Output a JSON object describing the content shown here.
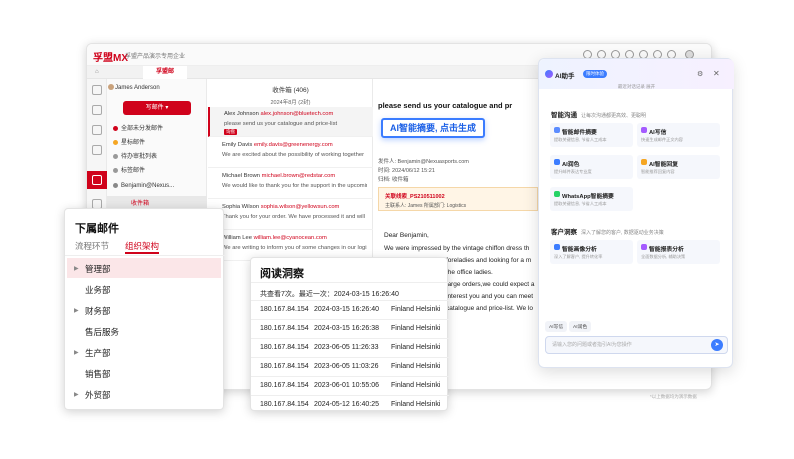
{
  "app": {
    "logo": "孚盟MX",
    "org": "孚盟产品演示专用企业",
    "tabs": {
      "home": "⌂",
      "active": "孚盟邮"
    }
  },
  "folders": {
    "user": "James Anderson",
    "compose": "写邮件 ▾",
    "items": [
      "全部未分发邮件",
      "星标邮件",
      "待办审批列表",
      "标签邮件",
      "Benjamin@Nexus...",
      "收件箱"
    ]
  },
  "list": {
    "title": "收件箱 (406)",
    "date": "2024年8月 (2封)",
    "mails": [
      {
        "name": "Alex Johnson",
        "email": "alex.johnson@bluetech.com",
        "snippet": "please send us your catalogue and price-list",
        "tag": "询盘"
      },
      {
        "name": "Emily Davis",
        "email": "emily.davis@greenenergy.com",
        "snippet": "We are excited about the possibility of working together",
        "tag": ""
      },
      {
        "name": "Michael Brown",
        "email": "michael.brown@redstar.com",
        "snippet": "We would like to thank you for the support in the upcoming",
        "tag": ""
      },
      {
        "name": "Sophia Wilson",
        "email": "sophia.wilson@yellowsun.com",
        "snippet": "Thank you for your order. We have processed it and will",
        "tag": ""
      },
      {
        "name": "William Lee",
        "email": "william.lee@cyanocean.com",
        "snippet": "We are writing to inform you of some changes in our logistics",
        "tag": ""
      }
    ]
  },
  "reader": {
    "subject": "please send us your catalogue and pr",
    "from": "发件人: Benjamin@Nexuasports.com",
    "time": "时间: 2024/06/12 15:21",
    "folder": "归档: 收件箱",
    "link_title": "关联线索_PS210511002",
    "link_detail": "主联系人: James   所属部门: Logistics",
    "greeting": "Dear Benjamin,",
    "lines": [
      "We were impressed by the vintage chiffon dress th",
      "foreladies and looking for a m",
      "the office ladies.",
      "large orders,we could expect a",
      "interest you and you can meet",
      "catalogue and price-list. We lo"
    ]
  },
  "ai_summary": "AI智能摘要, 点击生成",
  "ai": {
    "title": "AI助手",
    "badge": "限时体验",
    "sub": "最近对话记录  展开",
    "section1": {
      "title": "智能沟通",
      "desc": "让每次沟通都更高效、更聪明"
    },
    "cards1": [
      {
        "t": "智能邮件摘要",
        "d": "提取关键信息, 节省人工成本",
        "color": "#5b8cff"
      },
      {
        "t": "AI写信",
        "d": "快速生成邮件正文内容",
        "color": "#a45bff"
      },
      {
        "t": "AI润色",
        "d": "提升邮件表达专业度",
        "color": "#3b7cff"
      },
      {
        "t": "AI智能回复",
        "d": "智能推荐回复内容",
        "color": "#f5a623"
      },
      {
        "t": "WhatsApp智能摘要",
        "d": "提取关键信息, 节省人工成本",
        "color": "#25d366"
      }
    ],
    "section2": {
      "title": "客户洞察",
      "desc": "深入了解您的客户, 数据驱动业务决策"
    },
    "cards2": [
      {
        "t": "智能画像分析",
        "d": "深入了解客户, 提升转化率",
        "color": "#3b7cff"
      },
      {
        "t": "智能报表分析",
        "d": "全面数据分析, 辅助决策",
        "color": "#a45bff"
      }
    ],
    "chips": [
      "AI写信",
      "AI润色"
    ],
    "input_placeholder": "请输入您的问题或者指引AI为您操作",
    "send": "➤",
    "footer": "*以上数据均为演示数据"
  },
  "org": {
    "title": "下属邮件",
    "tabs": [
      "流程环节",
      "组织架构"
    ],
    "items": [
      {
        "label": "管理部",
        "expand": true
      },
      {
        "label": "业务部",
        "expand": false
      },
      {
        "label": "财务部",
        "expand": true
      },
      {
        "label": "售后服务",
        "expand": false
      },
      {
        "label": "生产部",
        "expand": true
      },
      {
        "label": "销售部",
        "expand": false
      },
      {
        "label": "外贸部",
        "expand": true
      }
    ]
  },
  "tracking": {
    "title": "阅读洞察",
    "summary": "共查看7次。最近一次：2024-03-15 16:26:40",
    "rows": [
      [
        "180.167.84.154",
        "2024-03-15 16:26:40",
        "Finland Helsinki"
      ],
      [
        "180.167.84.154",
        "2024-03-15 16:26:38",
        "Finland Helsinki"
      ],
      [
        "180.167.84.154",
        "2023-06-05 11:26:33",
        "Finland Helsinki"
      ],
      [
        "180.167.84.154",
        "2023-06-05 11:03:26",
        "Finland Helsinki"
      ],
      [
        "180.167.84.154",
        "2023-06-01 10:55:06",
        "Finland Helsinki"
      ],
      [
        "180.167.84.154",
        "2024-05-12 16:40:25",
        "Finland Helsinki"
      ]
    ]
  }
}
